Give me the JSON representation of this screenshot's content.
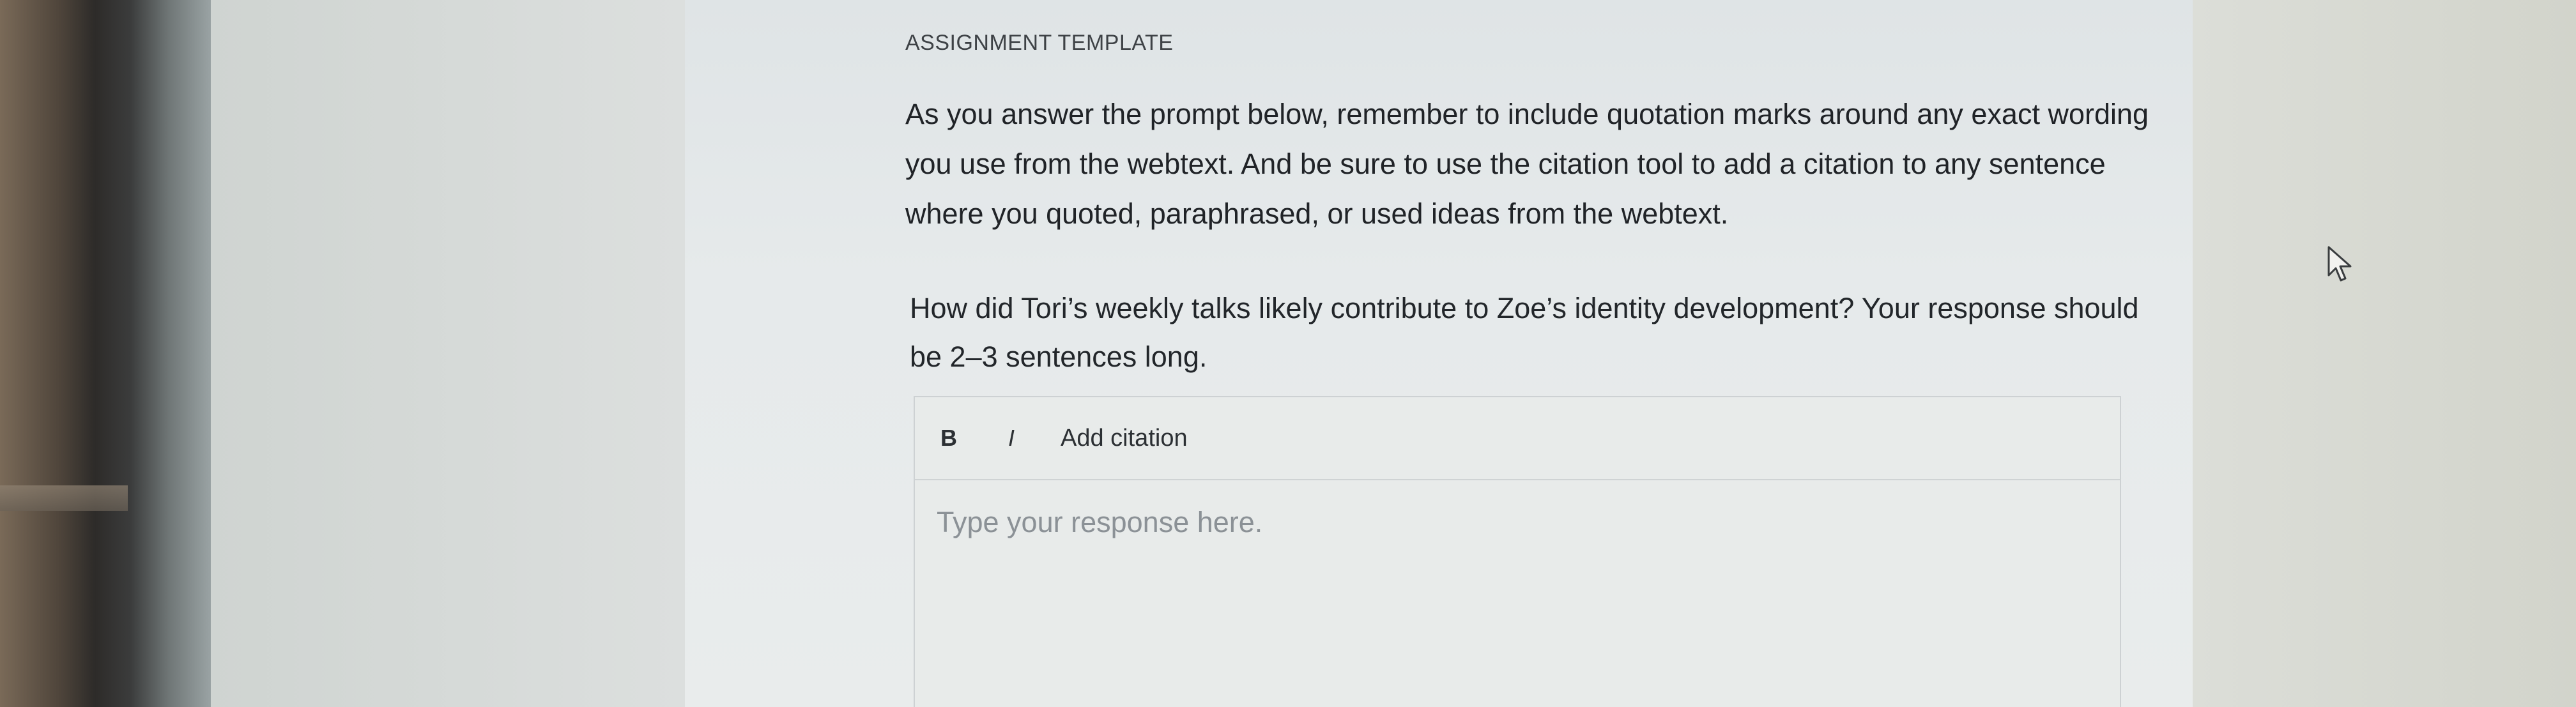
{
  "assignment": {
    "label": "ASSIGNMENT TEMPLATE",
    "instructions": "As you answer the prompt below, remember to include quotation marks around any exact wording you use from the webtext. And be sure to use the citation tool to add a citation to any sentence where you quoted, paraphrased, or used ideas from the webtext.",
    "prompt": "How did Tori’s weekly talks likely contribute to Zoe’s identity development? Your response should be 2–3 sentences long."
  },
  "editor": {
    "bold_label": "B",
    "italic_label": "I",
    "citation_label": "Add citation",
    "placeholder": "Type your response here.",
    "value": ""
  },
  "icons": {
    "pointer": "mouse-pointer-icon"
  }
}
